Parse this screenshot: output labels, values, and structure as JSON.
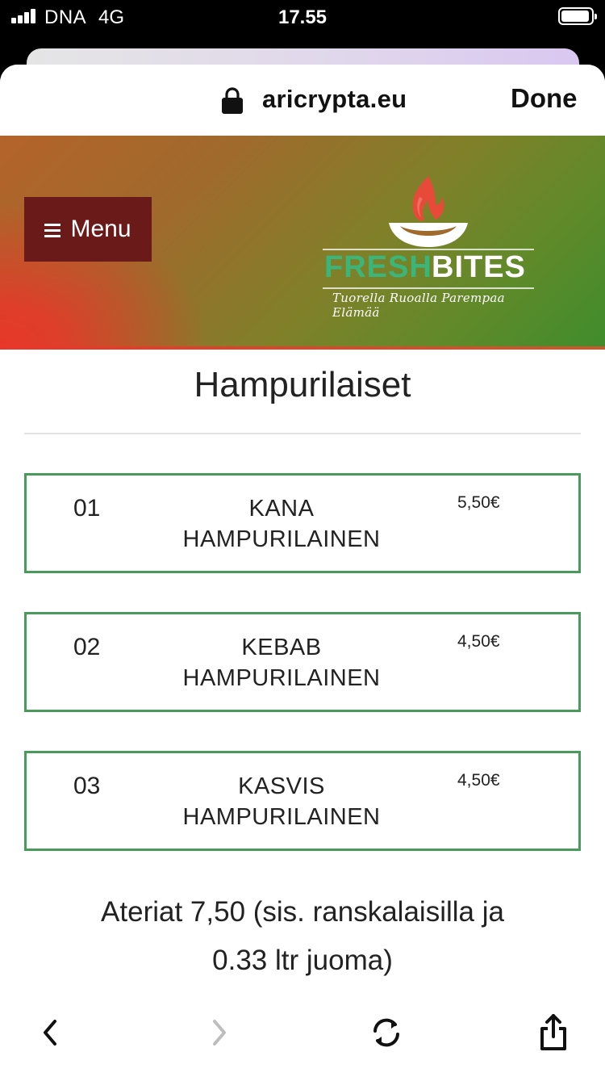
{
  "status_bar": {
    "carrier": "DNA",
    "network": "4G",
    "time": "17.55"
  },
  "browser": {
    "url": "aricrypta.eu",
    "done_label": "Done"
  },
  "site": {
    "menu_label": "Menu",
    "logo": {
      "word1": "FRESH",
      "word2": "BITES",
      "tagline": "Tuorella Ruoalla Parempaa Elämää",
      "colors": {
        "fresh": "#3cb57a",
        "flame": "#e8372a"
      }
    },
    "page_title": "Hampurilaiset",
    "items": [
      {
        "number": "01",
        "name_line1": "KANA",
        "name_line2": "HAMPURILAINEN",
        "price": "5,50€"
      },
      {
        "number": "02",
        "name_line1": "KEBAB",
        "name_line2": "HAMPURILAINEN",
        "price": "4,50€"
      },
      {
        "number": "03",
        "name_line1": "KASVIS",
        "name_line2": "HAMPURILAINEN",
        "price": "4,50€"
      }
    ],
    "note_line1": "Ateriat 7,50 (sis. ranskalaisilla ja",
    "note_line2": "0.33 ltr juoma)",
    "accent_color": "#4a9a5e",
    "menu_button_color": "#6b1a1a"
  },
  "toolbar": {
    "back_icon": "chevron-left-icon",
    "forward_icon": "chevron-right-icon",
    "reload_icon": "reload-icon",
    "share_icon": "share-icon"
  }
}
